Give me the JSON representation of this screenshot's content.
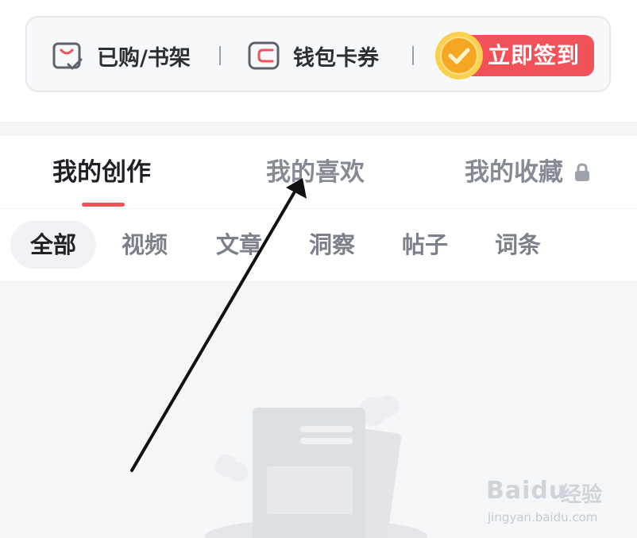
{
  "topbar": {
    "shelf": {
      "label": "已购/书架",
      "icon": "shelf-check-icon"
    },
    "wallet": {
      "label": "钱包卡券",
      "icon": "wallet-icon"
    },
    "signin": {
      "label": "立即签到",
      "icon": "gold-coin-icon"
    }
  },
  "tabs": [
    {
      "label": "我的创作",
      "active": true
    },
    {
      "label": "我的喜欢",
      "active": false
    },
    {
      "label": "我的收藏",
      "active": false,
      "locked": true
    }
  ],
  "subtabs": [
    {
      "label": "全部",
      "active": true
    },
    {
      "label": "视频"
    },
    {
      "label": "文章"
    },
    {
      "label": "洞察"
    },
    {
      "label": "帖子"
    },
    {
      "label": "词条"
    }
  ],
  "watermark": {
    "brand": "Baidu",
    "cn": "经验",
    "url": "jingyan.baidu.com"
  },
  "colors": {
    "accent": "#f1525a",
    "text_primary": "#1f2127",
    "text_secondary": "#858a94",
    "coin": "#f5b324",
    "background_empty": "#f5f6f8"
  }
}
